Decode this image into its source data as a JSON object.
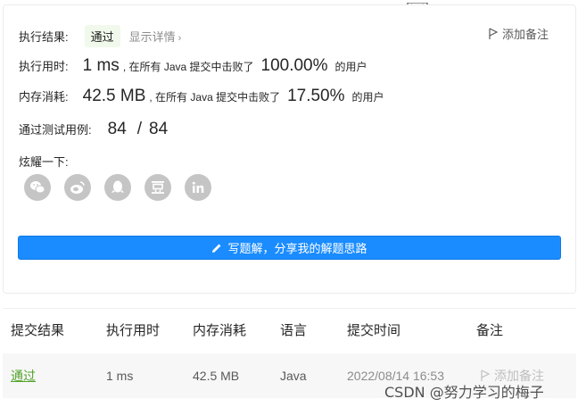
{
  "result": {
    "exec_result_label": "执行结果:",
    "status": "通过",
    "show_details": "显示详情",
    "add_note": "添加备注",
    "runtime_label": "执行用时:",
    "runtime_value": "1 ms",
    "runtime_text_prefix": ", 在所有 Java 提交中击败了",
    "runtime_percent": "100.00%",
    "runtime_text_suffix": "的用户",
    "memory_label": "内存消耗:",
    "memory_value": "42.5 MB",
    "memory_text_prefix": ", 在所有 Java 提交中击败了",
    "memory_percent": "17.50%",
    "memory_text_suffix": "的用户",
    "tests_label": "通过测试用例:",
    "tests_passed": "84",
    "tests_separator": "/",
    "tests_total": "84",
    "share_label": "炫耀一下:",
    "share_icons": [
      "wechat-icon",
      "weibo-icon",
      "qq-icon",
      "douban-icon",
      "linkedin-icon"
    ],
    "solution_button_label": "写题解，分享我的解题思路"
  },
  "table": {
    "headers": [
      "提交结果",
      "执行用时",
      "内存消耗",
      "语言",
      "提交时间",
      "备注"
    ],
    "rows": [
      {
        "status": "通过",
        "runtime": "1 ms",
        "memory": "42.5 MB",
        "language": "Java",
        "time": "2022/08/14 16:53",
        "note": "添加备注"
      }
    ]
  },
  "watermark": "CSDN @努力学习的梅子",
  "colors": {
    "primary_button": "#1a8cff",
    "accepted_green": "#52a32a",
    "badge_bg": "#f0f9eb",
    "share_icon_bg": "#c5c5c5"
  }
}
